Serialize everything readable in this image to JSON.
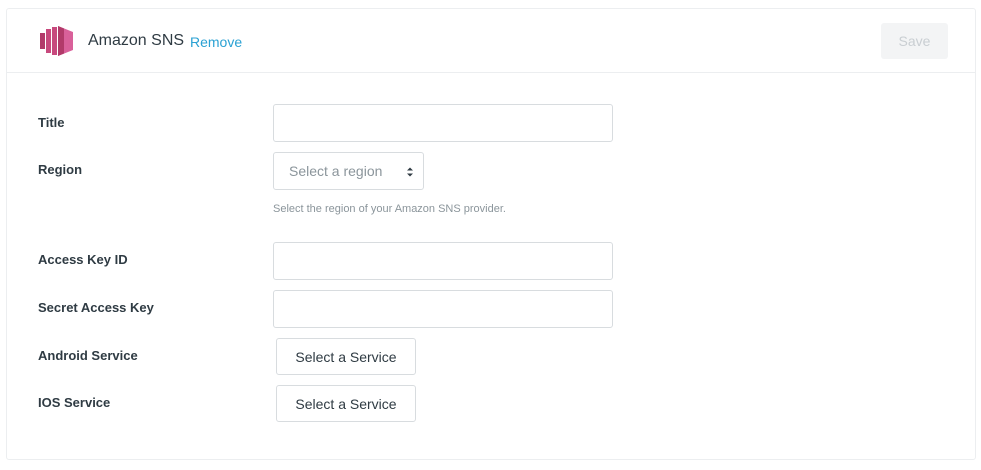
{
  "header": {
    "provider_name": "Amazon SNS",
    "remove_label": "Remove",
    "save_label": "Save",
    "logo_icon": "amazon-sns-logo-icon",
    "logo_color": "#c7497d"
  },
  "form": {
    "title": {
      "label": "Title",
      "value": ""
    },
    "region": {
      "label": "Region",
      "placeholder": "Select a region",
      "help": "Select the region of your Amazon SNS provider."
    },
    "access_key_id": {
      "label": "Access Key ID",
      "value": ""
    },
    "secret_access_key": {
      "label": "Secret Access Key",
      "value": ""
    },
    "android_service": {
      "label": "Android Service",
      "button_label": "Select a Service"
    },
    "ios_service": {
      "label": "IOS Service",
      "button_label": "Select a Service"
    }
  },
  "colors": {
    "link": "#2aa1d3",
    "text": "#2f3b43",
    "muted": "#8b959b",
    "border": "#d8dcdf",
    "save_disabled_bg": "#f3f4f5"
  }
}
